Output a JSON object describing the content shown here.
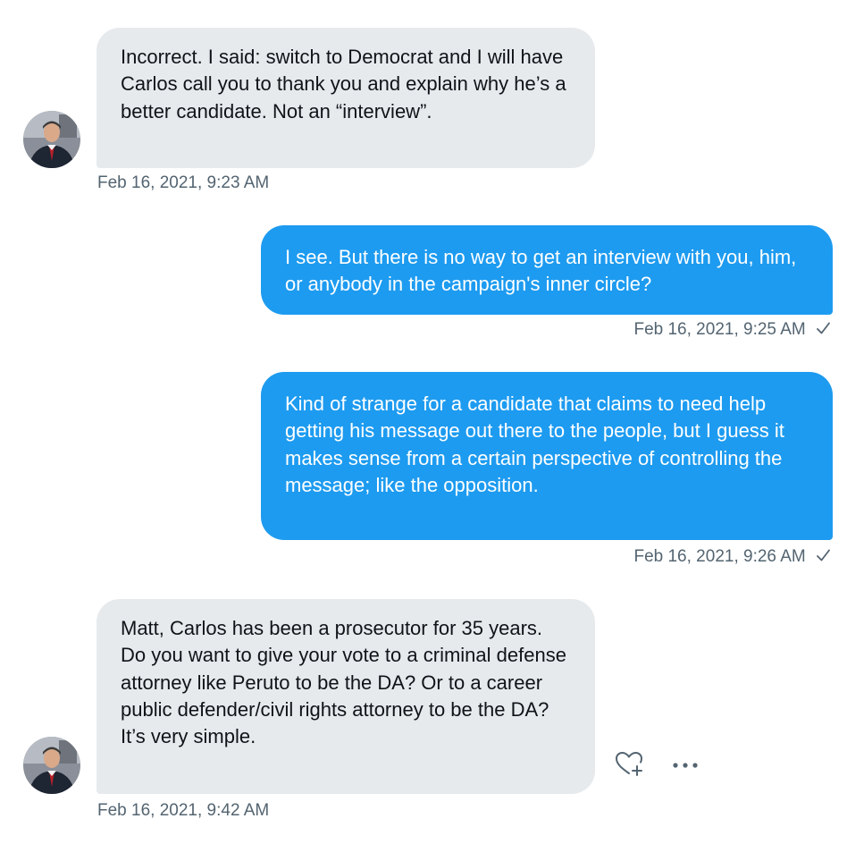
{
  "messages": [
    {
      "direction": "incoming",
      "text": "Incorrect.  I said: switch to Democrat and I will have Carlos call you to thank you and explain why he’s a better candidate.  Not an “interview”.",
      "timestamp": "Feb 16, 2021, 9:23 AM"
    },
    {
      "direction": "outgoing",
      "text": "I see. But there is no way to get an interview with you, him, or anybody in the campaign's inner circle?",
      "timestamp": "Feb 16, 2021, 9:25 AM",
      "status_icon": "check-icon"
    },
    {
      "direction": "outgoing",
      "text": "Kind of strange for a candidate that claims to need help getting his message out there to the people, but I guess it makes sense from a certain perspective of controlling the message; like the opposition.",
      "timestamp": "Feb 16, 2021, 9:26 AM",
      "status_icon": "check-icon"
    },
    {
      "direction": "incoming",
      "text": "Matt, Carlos has been a prosecutor for 35 years.  Do you want to give your vote to a criminal defense attorney like Peruto to be the DA?  Or to a career public defender/civil rights attorney to be the DA?  It’s very simple.",
      "timestamp": "Feb 16, 2021, 9:42 AM"
    }
  ],
  "actions": {
    "react_icon": "heart-plus-icon",
    "more_icon": "more-horizontal-icon"
  },
  "colors": {
    "incoming_bubble": "#e7eaed",
    "outgoing_bubble": "#1d9bf0",
    "timestamp": "#536471",
    "text": "#0f1419"
  }
}
